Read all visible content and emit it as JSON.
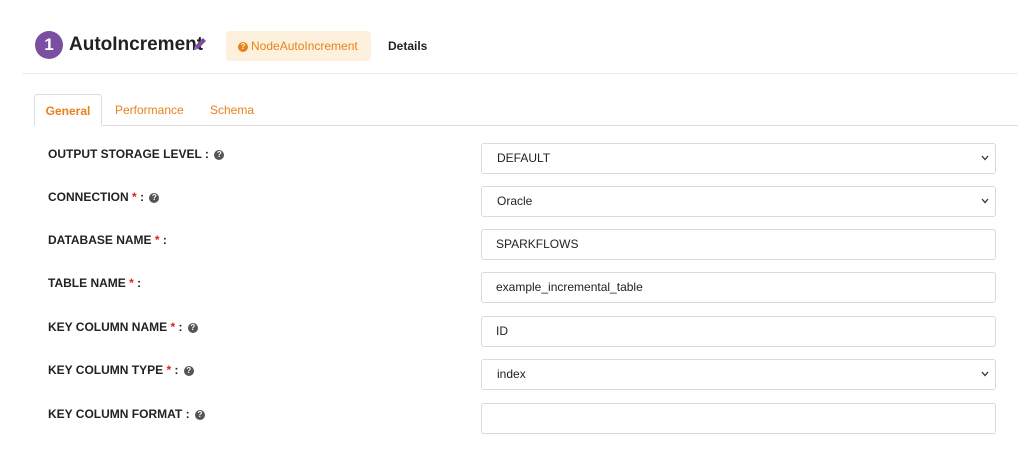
{
  "header": {
    "step_number": "1",
    "node_title": "AutoIncrement",
    "node_class": "NodeAutoIncrement",
    "details_label": "Details"
  },
  "tabs": [
    {
      "label": "General",
      "active": true
    },
    {
      "label": "Performance",
      "active": false
    },
    {
      "label": "Schema",
      "active": false
    }
  ],
  "form": {
    "output_storage_level": {
      "label": "OUTPUT STORAGE LEVEL",
      "value": "DEFAULT"
    },
    "connection": {
      "label": "CONNECTION",
      "value": "Oracle"
    },
    "database_name": {
      "label": "DATABASE NAME",
      "value": "SPARKFLOWS"
    },
    "table_name": {
      "label": "TABLE NAME",
      "value": "example_incremental_table"
    },
    "key_column_name": {
      "label": "KEY COLUMN NAME",
      "value": "ID"
    },
    "key_column_type": {
      "label": "KEY COLUMN TYPE",
      "value": "index"
    },
    "key_column_format": {
      "label": "KEY COLUMN FORMAT",
      "value": ""
    }
  },
  "symbols": {
    "required": "*",
    "colon": ":",
    "help": "?"
  },
  "colors": {
    "accent": "#e8821c",
    "step_badge": "#7b4fa0",
    "required": "#e02020"
  }
}
